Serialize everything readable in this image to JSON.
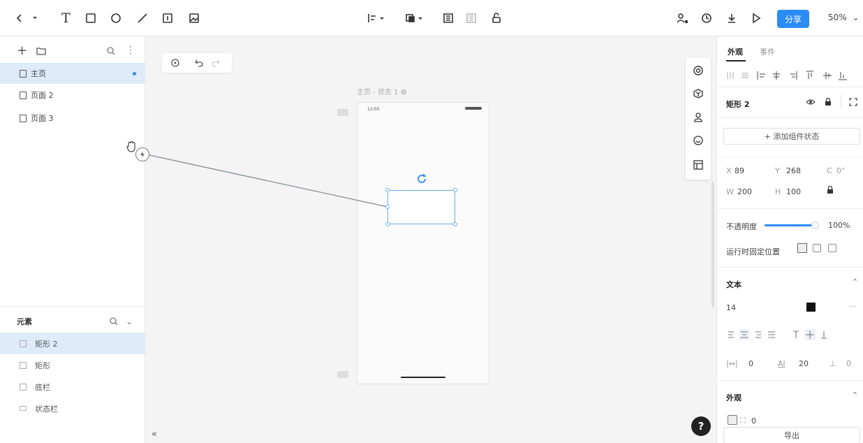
{
  "toolbar": {
    "share_label": "分享",
    "zoom": "50%"
  },
  "pages": {
    "items": [
      {
        "label": "主页",
        "active": true
      },
      {
        "label": "页面 2",
        "active": false
      },
      {
        "label": "页面 3",
        "active": false
      }
    ]
  },
  "elements": {
    "title": "元素",
    "items": [
      {
        "label": "矩形 2",
        "active": true
      },
      {
        "label": "矩形",
        "active": false
      },
      {
        "label": "底栏",
        "active": false
      },
      {
        "label": "状态栏",
        "active": false
      }
    ]
  },
  "canvas": {
    "frame_label": "主页 - 状态 1",
    "status_time": "12:00"
  },
  "inspector": {
    "tab_appearance": "外观",
    "tab_events": "事件",
    "component_name": "矩形 2",
    "add_state": "+ 添加组件状态",
    "x_label": "X",
    "x_value": "89",
    "y_label": "Y",
    "y_value": "268",
    "rotation_label": "C",
    "rotation_value": "0°",
    "w_label": "W",
    "w_value": "200",
    "h_label": "H",
    "h_value": "100",
    "opacity_label": "不透明度",
    "opacity_value": "100%",
    "opacity_fraction": 1.0,
    "fixed_position_label": "运行时固定位置",
    "text_section": "文本",
    "font_size": "14",
    "more": "···",
    "letter_spacing": "0",
    "line_height": "20",
    "paragraph_spacing": "0",
    "appearance_section": "外观",
    "corner_radius": "0",
    "export_label": "导出"
  }
}
